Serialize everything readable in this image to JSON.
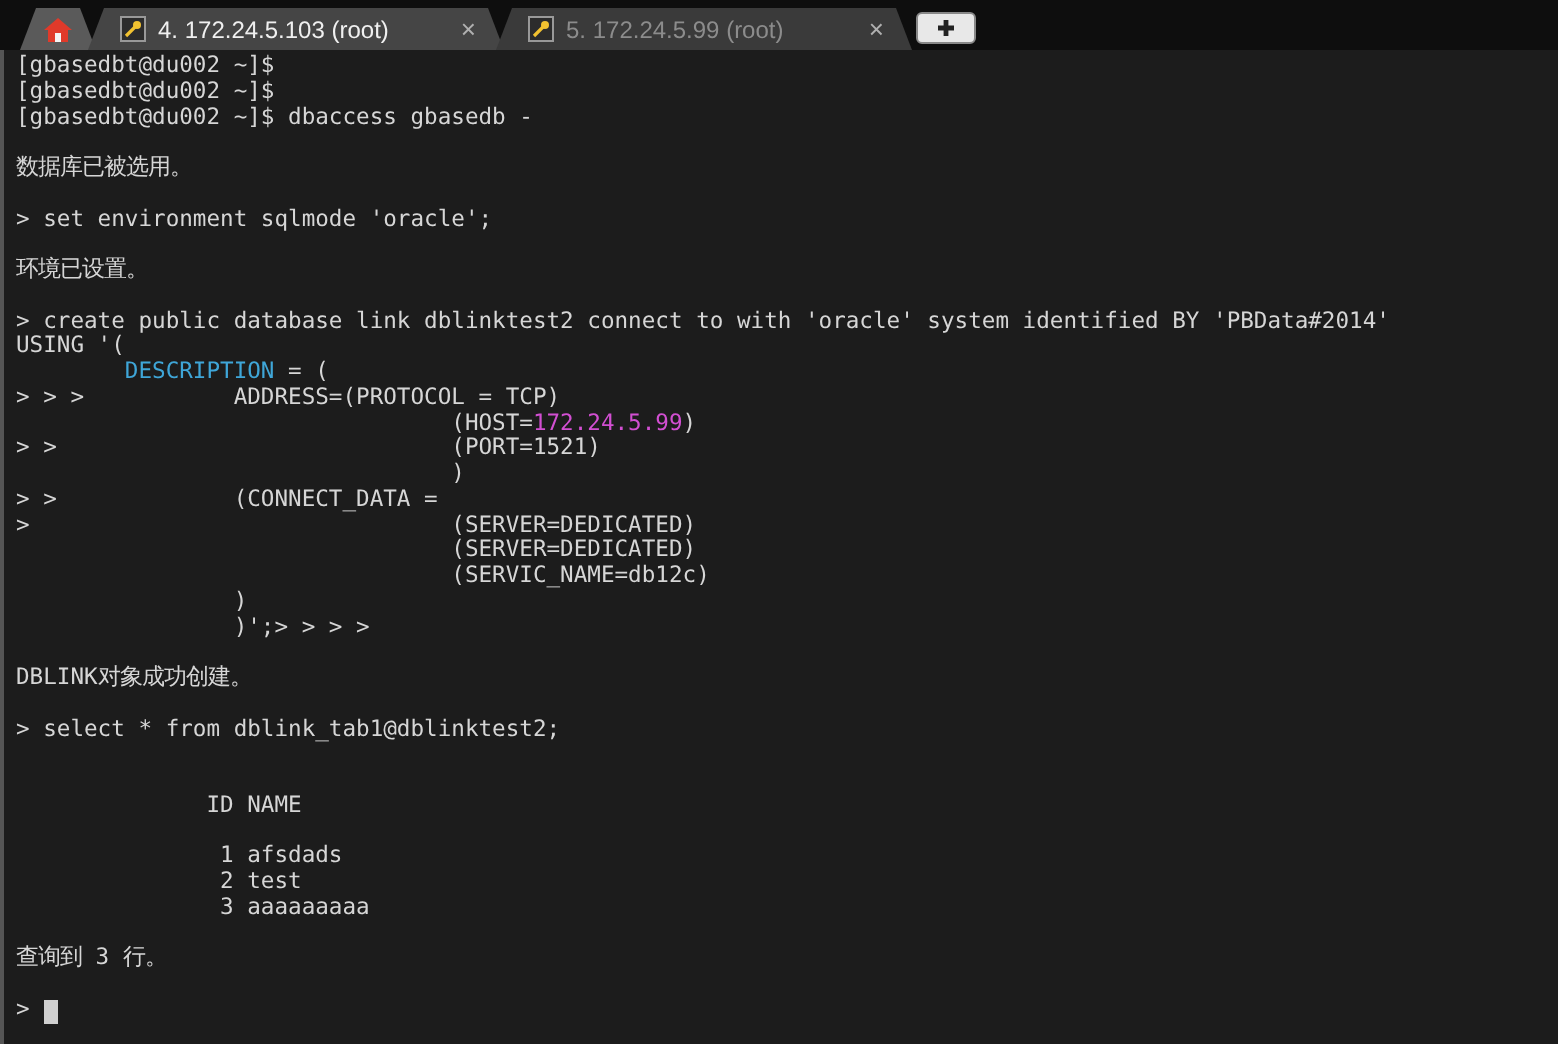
{
  "tabs": [
    {
      "kind": "home",
      "selected": false
    },
    {
      "kind": "session",
      "title": "4. 172.24.5.103 (root)",
      "close": "×",
      "selected": true
    },
    {
      "kind": "session",
      "title": "5. 172.24.5.99 (root)",
      "close": "×",
      "selected": false
    },
    {
      "kind": "new"
    }
  ],
  "terminal": {
    "lines": [
      {
        "kind": "text",
        "segments": [
          {
            "text": "[gbasedbt@du002 ~]$"
          }
        ]
      },
      {
        "kind": "text",
        "segments": [
          {
            "text": "[gbasedbt@du002 ~]$"
          }
        ]
      },
      {
        "kind": "text",
        "segments": [
          {
            "text": "[gbasedbt@du002 ~]$ dbaccess gbasedb -"
          }
        ]
      },
      {
        "kind": "blank"
      },
      {
        "kind": "text",
        "segments": [
          {
            "text": "数据库已被选用。"
          }
        ]
      },
      {
        "kind": "blank"
      },
      {
        "kind": "text",
        "segments": [
          {
            "text": "> set environment sqlmode 'oracle';"
          }
        ]
      },
      {
        "kind": "blank"
      },
      {
        "kind": "text",
        "segments": [
          {
            "text": "环境已设置。"
          }
        ]
      },
      {
        "kind": "blank"
      },
      {
        "kind": "text",
        "segments": [
          {
            "text": "> create public database link dblinktest2 connect to with 'oracle' system identified BY 'PBData#2014'"
          }
        ]
      },
      {
        "kind": "text",
        "segments": [
          {
            "text": "USING '("
          }
        ]
      },
      {
        "kind": "text",
        "segments": [
          {
            "text": "        DESCRIPTION",
            "color": "#3fa6d8"
          },
          {
            "text": " = ("
          }
        ]
      },
      {
        "kind": "text",
        "segments": [
          {
            "text": "> > >           ADDRESS=(PROTOCOL = TCP)"
          }
        ]
      },
      {
        "kind": "text",
        "segments": [
          {
            "text": "                                (HOST="
          },
          {
            "text": "172.24.5.99",
            "color": "#d24fd2"
          },
          {
            "text": ")"
          }
        ]
      },
      {
        "kind": "text",
        "segments": [
          {
            "text": "> >                             (PORT=1521)"
          }
        ]
      },
      {
        "kind": "text",
        "segments": [
          {
            "text": "                                )"
          }
        ]
      },
      {
        "kind": "text",
        "segments": [
          {
            "text": "> >             (CONNECT_DATA ="
          }
        ]
      },
      {
        "kind": "text",
        "segments": [
          {
            "text": ">                               (SERVER=DEDICATED)"
          }
        ]
      },
      {
        "kind": "text",
        "segments": [
          {
            "text": "                                (SERVER=DEDICATED)"
          }
        ]
      },
      {
        "kind": "text",
        "segments": [
          {
            "text": "                                (SERVIC_NAME=db12c)"
          }
        ]
      },
      {
        "kind": "text",
        "segments": [
          {
            "text": "                )"
          }
        ]
      },
      {
        "kind": "text",
        "segments": [
          {
            "text": "                )';> > > >"
          }
        ]
      },
      {
        "kind": "blank"
      },
      {
        "kind": "text",
        "segments": [
          {
            "text": "DBLINK对象成功创建。"
          }
        ]
      },
      {
        "kind": "blank"
      },
      {
        "kind": "text",
        "segments": [
          {
            "text": "> select * from dblink_tab1@dblinktest2;"
          }
        ]
      },
      {
        "kind": "blank"
      },
      {
        "kind": "blank"
      },
      {
        "kind": "text",
        "segments": [
          {
            "text": "              ID NAME"
          }
        ]
      },
      {
        "kind": "blank"
      },
      {
        "kind": "text",
        "segments": [
          {
            "text": "               1 afsdads"
          }
        ]
      },
      {
        "kind": "text",
        "segments": [
          {
            "text": "               2 test"
          }
        ]
      },
      {
        "kind": "text",
        "segments": [
          {
            "text": "               3 aaaaaaaaa"
          }
        ]
      },
      {
        "kind": "blank"
      },
      {
        "kind": "text",
        "segments": [
          {
            "text": "查询到 3 行。"
          }
        ]
      },
      {
        "kind": "blank"
      },
      {
        "kind": "prompt",
        "segments": [
          {
            "text": "> "
          }
        ]
      }
    ]
  }
}
